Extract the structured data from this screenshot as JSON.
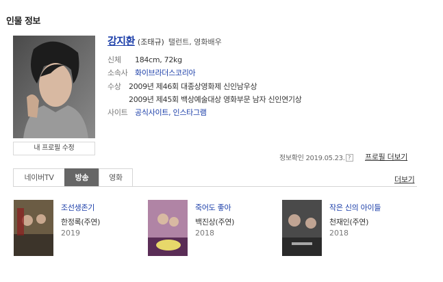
{
  "section_title": "인물 정보",
  "person": {
    "name": "강지환",
    "real_name": "(조태규)",
    "occupation": "탤런트, 영화배우",
    "body_label": "신체",
    "body_value": "184cm, 72kg",
    "agency_label": "소속사",
    "agency_value": "화이브라더스코리아",
    "awards_label": "수상",
    "awards": [
      "2009년 제46회 대종상영화제 신인남우상",
      "2009년 제45회 백상예술대상 영화부문 남자 신인연기상"
    ],
    "site_label": "사이트",
    "site_value": "공식사이트, 인스타그램"
  },
  "edit_profile_label": "내 프로필 수정",
  "verify_text": "정보확인 2019.05.23.",
  "verify_icon": "?",
  "more_profile_label": "프로필 더보기",
  "tabs": [
    {
      "label": "네이버TV",
      "active": false
    },
    {
      "label": "방송",
      "active": true
    },
    {
      "label": "영화",
      "active": false
    }
  ],
  "more_list_label": "더보기",
  "works": [
    {
      "title": "조선생존기",
      "role": "한정록(주연)",
      "year": "2019"
    },
    {
      "title": "죽어도 좋아",
      "role": "백진상(주연)",
      "year": "2018"
    },
    {
      "title": "작은 신의 아이들",
      "role": "천재인(주연)",
      "year": "2018"
    }
  ],
  "colors": {
    "link": "#1a3da8",
    "active_tab": "#666666"
  }
}
